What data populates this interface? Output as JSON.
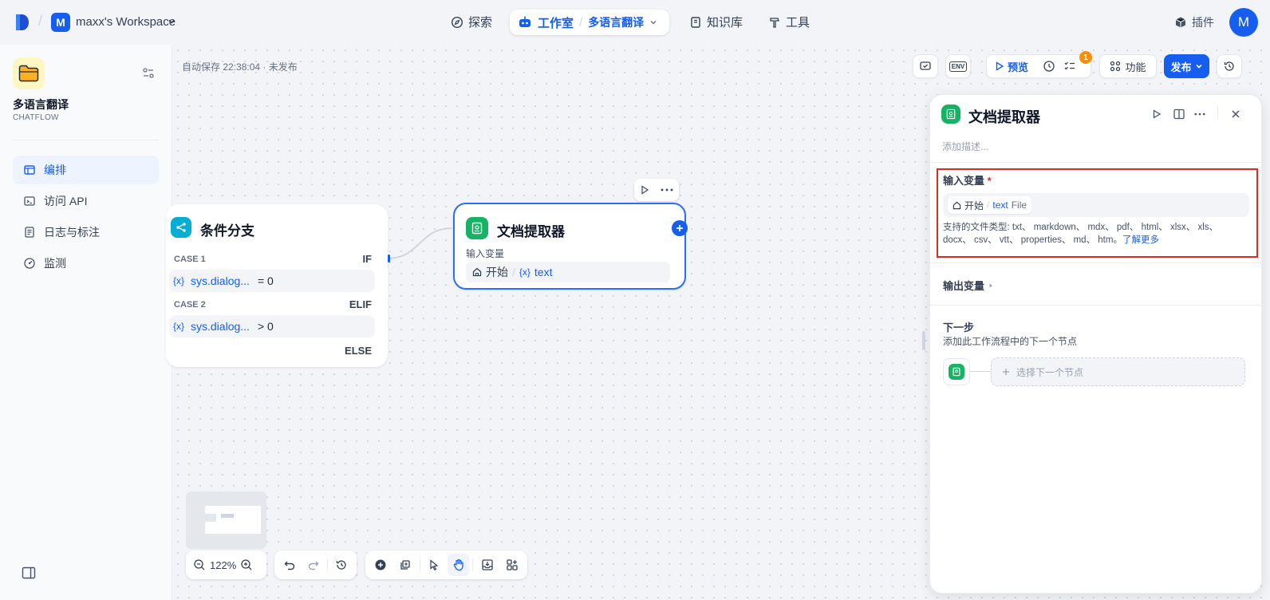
{
  "topbar": {
    "workspace_initial": "M",
    "workspace_name": "maxx's Workspace",
    "nav": {
      "explore": "探索",
      "studio": "工作室",
      "app": "多语言翻译",
      "knowledge": "知识库",
      "tools": "工具"
    },
    "plugins": "插件",
    "user_initial": "M"
  },
  "sidebar": {
    "app_name": "多语言翻译",
    "app_type": "CHATFLOW",
    "items": [
      {
        "label": "编排",
        "icon": "layout-icon"
      },
      {
        "label": "访问 API",
        "icon": "terminal-icon"
      },
      {
        "label": "日志与标注",
        "icon": "log-icon"
      },
      {
        "label": "监测",
        "icon": "gauge-icon"
      }
    ]
  },
  "canvas": {
    "autosave": "自动保存 22:38:04 · 未发布",
    "toolbar": {
      "env": "ENV",
      "preview": "预览",
      "checklist_count": "1",
      "features": "功能",
      "publish": "发布"
    },
    "zoom": "122%"
  },
  "if_node": {
    "title": "条件分支",
    "case1": "CASE 1",
    "if_kw": "IF",
    "cond1_var": "sys.dialog...",
    "cond1_op": "= 0",
    "case2": "CASE 2",
    "elif_kw": "ELIF",
    "cond2_var": "sys.dialog...",
    "cond2_op": "> 0",
    "else_kw": "ELSE"
  },
  "extractor_node": {
    "title": "文档提取器",
    "input_label": "输入变量",
    "source": "开始",
    "var": "text"
  },
  "panel": {
    "title": "文档提取器",
    "desc_placeholder": "添加描述...",
    "input_title": "输入变量",
    "required_mark": "*",
    "var_source": "开始",
    "var_name": "text",
    "var_type": "File",
    "file_types_prefix": "支持的文件类型: txt、 markdown、 mdx、 pdf、 html、 xlsx、 xls、 docx、 csv、 vtt、 properties、 md、 htm。",
    "learn_more": "了解更多",
    "output_title": "输出变量",
    "next_title": "下一步",
    "next_desc": "添加此工作流程中的下一个节点",
    "next_select": "选择下一个节点"
  },
  "colors": {
    "accent": "#155eef",
    "if_node": "#06aed4",
    "extractor": "#16b364",
    "highlight": "#d92d20",
    "badge": "#f79009"
  }
}
